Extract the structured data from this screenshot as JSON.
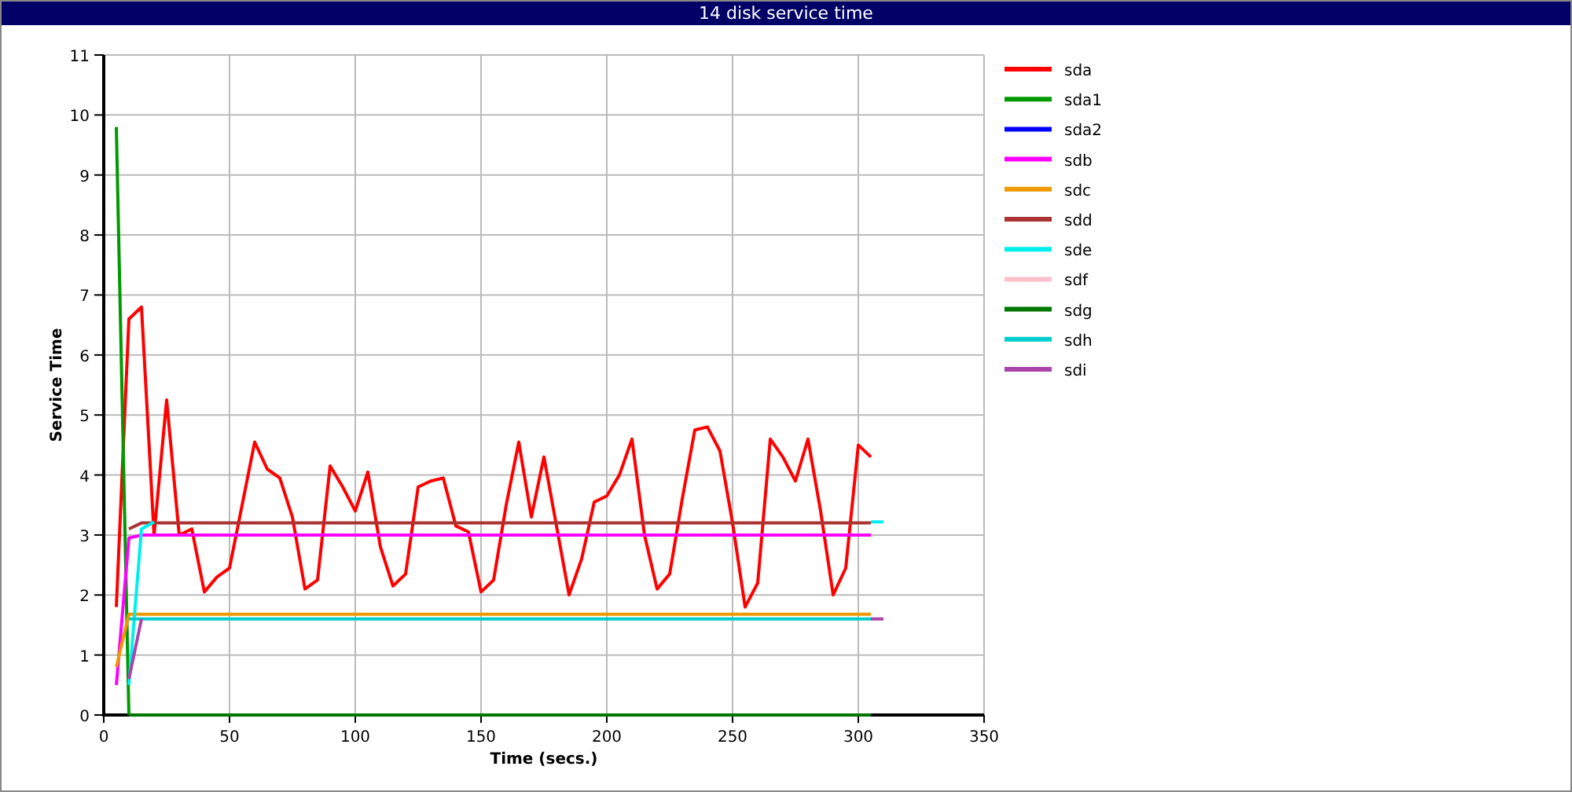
{
  "window": {
    "title": "14 disk service time"
  },
  "chart": {
    "chart_data": {
      "type": "line",
      "xlabel": "Time (secs.)",
      "ylabel": "Service Time",
      "xlim": [
        0,
        350
      ],
      "ylim": [
        0,
        11
      ],
      "grid": true,
      "legend": true,
      "xticks": [
        0,
        50,
        100,
        150,
        200,
        250,
        300,
        350
      ],
      "yticks": [
        0,
        1,
        2,
        3,
        4,
        5,
        6,
        7,
        8,
        9,
        10,
        11
      ],
      "x": [
        5,
        10,
        15,
        20,
        25,
        30,
        35,
        40,
        45,
        50,
        55,
        60,
        65,
        70,
        75,
        80,
        85,
        90,
        95,
        100,
        105,
        110,
        115,
        120,
        125,
        130,
        135,
        140,
        145,
        150,
        155,
        160,
        165,
        170,
        175,
        180,
        185,
        190,
        195,
        200,
        205,
        210,
        215,
        220,
        225,
        230,
        235,
        240,
        245,
        250,
        255,
        260,
        265,
        270,
        275,
        280,
        285,
        290,
        295,
        300,
        305,
        310
      ],
      "series": [
        {
          "name": "sda",
          "color": "#ff0000",
          "values": [
            1.8,
            6.6,
            6.8,
            3.0,
            5.25,
            3.0,
            3.1,
            2.05,
            2.3,
            2.45,
            3.5,
            4.55,
            4.1,
            3.95,
            3.3,
            2.1,
            2.25,
            4.15,
            3.8,
            3.4,
            4.05,
            2.8,
            2.15,
            2.35,
            3.8,
            3.9,
            3.95,
            3.15,
            3.05,
            2.05,
            2.25,
            3.5,
            4.55,
            3.3,
            4.3,
            3.15,
            2.0,
            2.6,
            3.55,
            3.65,
            4.0,
            4.6,
            3.0,
            2.1,
            2.35,
            3.6,
            4.75,
            4.8,
            4.4,
            3.2,
            1.8,
            2.2,
            4.6,
            4.3,
            3.9,
            4.6,
            3.4,
            2.0,
            2.45,
            4.5,
            4.3,
            null
          ]
        },
        {
          "name": "sda1",
          "color": "#009900",
          "values": [
            9.8,
            0,
            null,
            null,
            null,
            null,
            null,
            null,
            null,
            null,
            null,
            null,
            null,
            null,
            null,
            null,
            null,
            null,
            null,
            null,
            null,
            null,
            null,
            null,
            null,
            null,
            null,
            null,
            null,
            null,
            null,
            null,
            null,
            null,
            null,
            null,
            null,
            null,
            null,
            null,
            null,
            null,
            null,
            null,
            null,
            null,
            null,
            null,
            null,
            null,
            null,
            null,
            null,
            null,
            null,
            null,
            null,
            null,
            null,
            null,
            null,
            null
          ]
        },
        {
          "name": "sda2",
          "color": "#0000ff",
          "values": [
            null,
            null,
            null,
            null,
            null,
            null,
            null,
            null,
            null,
            null,
            null,
            null,
            null,
            null,
            null,
            null,
            null,
            null,
            null,
            null,
            null,
            null,
            null,
            null,
            null,
            null,
            null,
            null,
            null,
            null,
            null,
            null,
            null,
            null,
            null,
            null,
            null,
            null,
            null,
            null,
            null,
            null,
            null,
            null,
            null,
            null,
            null,
            null,
            null,
            null,
            null,
            null,
            null,
            null,
            null,
            null,
            null,
            null,
            null,
            null,
            null,
            null
          ]
        },
        {
          "name": "sdb",
          "color": "#ff00ff",
          "values": [
            0.5,
            2.95,
            3,
            3,
            3,
            3,
            3,
            3,
            3,
            3,
            3,
            3,
            3,
            3,
            3,
            3,
            3,
            3,
            3,
            3,
            3,
            3,
            3,
            3,
            3,
            3,
            3,
            3,
            3,
            3,
            3,
            3,
            3,
            3,
            3,
            3,
            3,
            3,
            3,
            3,
            3,
            3,
            3,
            3,
            3,
            3,
            3,
            3,
            3,
            3,
            3,
            3,
            3,
            3,
            3,
            3,
            3,
            3,
            3,
            3,
            3,
            null
          ]
        },
        {
          "name": "sdc",
          "color": "#ee9900",
          "values": [
            0.8,
            1.68,
            1.68,
            1.68,
            1.68,
            1.68,
            1.68,
            1.68,
            1.68,
            1.68,
            1.68,
            1.68,
            1.68,
            1.68,
            1.68,
            1.68,
            1.68,
            1.68,
            1.68,
            1.68,
            1.68,
            1.68,
            1.68,
            1.68,
            1.68,
            1.68,
            1.68,
            1.68,
            1.68,
            1.68,
            1.68,
            1.68,
            1.68,
            1.68,
            1.68,
            1.68,
            1.68,
            1.68,
            1.68,
            1.68,
            1.68,
            1.68,
            1.68,
            1.68,
            1.68,
            1.68,
            1.68,
            1.68,
            1.68,
            1.68,
            1.68,
            1.68,
            1.68,
            1.68,
            1.68,
            1.68,
            1.68,
            1.68,
            1.68,
            1.68,
            1.68,
            null
          ]
        },
        {
          "name": "sdd",
          "color": "#aa3333",
          "values": [
            null,
            3.1,
            3.2,
            3.2,
            3.2,
            3.2,
            3.2,
            3.2,
            3.2,
            3.2,
            3.2,
            3.2,
            3.2,
            3.2,
            3.2,
            3.2,
            3.2,
            3.2,
            3.2,
            3.2,
            3.2,
            3.2,
            3.2,
            3.2,
            3.2,
            3.2,
            3.2,
            3.2,
            3.2,
            3.2,
            3.2,
            3.2,
            3.2,
            3.2,
            3.2,
            3.2,
            3.2,
            3.2,
            3.2,
            3.2,
            3.2,
            3.2,
            3.2,
            3.2,
            3.2,
            3.2,
            3.2,
            3.2,
            3.2,
            3.2,
            3.2,
            3.2,
            3.2,
            3.2,
            3.2,
            3.2,
            3.2,
            3.2,
            3.2,
            3.2,
            3.2,
            null
          ]
        },
        {
          "name": "sde",
          "color": "#00eeee",
          "values": [
            null,
            0.5,
            3.1,
            3.22,
            null,
            null,
            null,
            null,
            null,
            null,
            null,
            null,
            null,
            null,
            null,
            null,
            null,
            null,
            null,
            null,
            null,
            null,
            null,
            null,
            null,
            null,
            null,
            null,
            null,
            null,
            null,
            null,
            null,
            null,
            null,
            null,
            null,
            null,
            null,
            null,
            null,
            null,
            null,
            null,
            null,
            null,
            null,
            null,
            null,
            null,
            null,
            null,
            null,
            null,
            null,
            null,
            null,
            null,
            null,
            null,
            3.22,
            3.22
          ]
        },
        {
          "name": "sdf",
          "color": "#ffc0cb",
          "values": [
            null,
            null,
            null,
            null,
            null,
            null,
            null,
            null,
            null,
            null,
            null,
            null,
            null,
            null,
            null,
            null,
            null,
            null,
            null,
            null,
            null,
            null,
            null,
            null,
            null,
            null,
            null,
            null,
            null,
            null,
            null,
            null,
            null,
            null,
            null,
            null,
            null,
            null,
            null,
            null,
            null,
            null,
            null,
            null,
            null,
            null,
            null,
            null,
            null,
            null,
            null,
            null,
            null,
            null,
            null,
            null,
            null,
            null,
            null,
            null,
            null,
            null
          ]
        },
        {
          "name": "sdg",
          "color": "#007700",
          "values": [
            null,
            0,
            0,
            0,
            0,
            0,
            0,
            0,
            0,
            0,
            0,
            0,
            0,
            0,
            0,
            0,
            0,
            0,
            0,
            0,
            0,
            0,
            0,
            0,
            0,
            0,
            0,
            0,
            0,
            0,
            0,
            0,
            0,
            0,
            0,
            0,
            0,
            0,
            0,
            0,
            0,
            0,
            0,
            0,
            0,
            0,
            0,
            0,
            0,
            0,
            0,
            0,
            0,
            0,
            0,
            0,
            0,
            0,
            0,
            0,
            0,
            null
          ]
        },
        {
          "name": "sdh",
          "color": "#00cccc",
          "values": [
            null,
            1.6,
            1.6,
            1.6,
            1.6,
            1.6,
            1.6,
            1.6,
            1.6,
            1.6,
            1.6,
            1.6,
            1.6,
            1.6,
            1.6,
            1.6,
            1.6,
            1.6,
            1.6,
            1.6,
            1.6,
            1.6,
            1.6,
            1.6,
            1.6,
            1.6,
            1.6,
            1.6,
            1.6,
            1.6,
            1.6,
            1.6,
            1.6,
            1.6,
            1.6,
            1.6,
            1.6,
            1.6,
            1.6,
            1.6,
            1.6,
            1.6,
            1.6,
            1.6,
            1.6,
            1.6,
            1.6,
            1.6,
            1.6,
            1.6,
            1.6,
            1.6,
            1.6,
            1.6,
            1.6,
            1.6,
            1.6,
            1.6,
            1.6,
            1.6,
            1.6,
            null
          ]
        },
        {
          "name": "sdi",
          "color": "#aa44aa",
          "values": [
            null,
            0.6,
            1.6,
            null,
            null,
            null,
            null,
            null,
            null,
            null,
            null,
            null,
            null,
            null,
            null,
            null,
            null,
            null,
            null,
            null,
            null,
            null,
            null,
            null,
            null,
            null,
            null,
            null,
            null,
            null,
            null,
            null,
            null,
            null,
            null,
            null,
            null,
            null,
            null,
            null,
            null,
            null,
            null,
            null,
            null,
            null,
            null,
            null,
            null,
            null,
            null,
            null,
            null,
            null,
            null,
            null,
            null,
            null,
            null,
            null,
            1.6,
            1.6
          ]
        }
      ]
    }
  }
}
